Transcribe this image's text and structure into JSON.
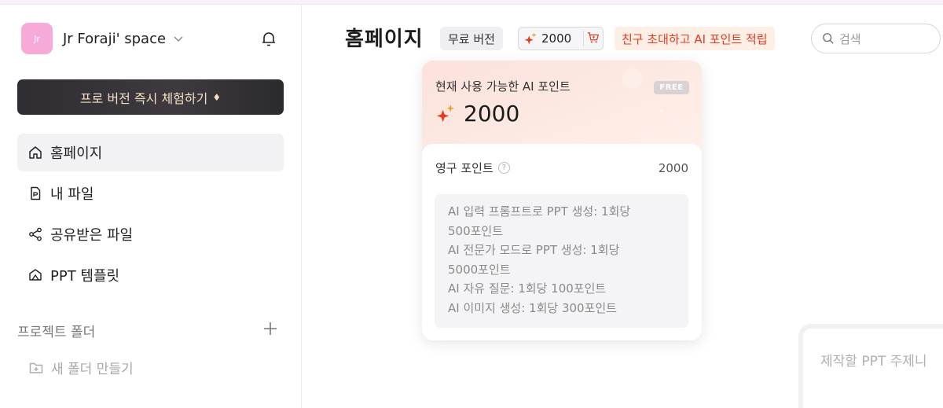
{
  "sidebar": {
    "workspace": {
      "avatar_text": "Jr",
      "name": "Jr Foraji' space"
    },
    "pro_button_label": "프로 버전 즉시 체험하기",
    "items": [
      {
        "label": "홈페이지",
        "icon": "home-icon",
        "active": true
      },
      {
        "label": "내 파일",
        "icon": "file-icon",
        "active": false
      },
      {
        "label": "공유받은 파일",
        "icon": "share-icon",
        "active": false
      },
      {
        "label": "PPT 템플릿",
        "icon": "template-icon",
        "active": false
      }
    ],
    "project_folder_label": "프로젝트 폴더",
    "new_folder_label": "새 폴더 만들기"
  },
  "header": {
    "title": "홈페이지",
    "plan_badge": "무료 버전",
    "points": "2000",
    "invite_label": "친구 초대하고 AI 포인트 적립",
    "search_placeholder": "검색"
  },
  "popover": {
    "available_label": "현재 사용 가능한 AI 포인트",
    "free_tag": "FREE",
    "available_points": "2000",
    "permanent_label": "영구 포인트",
    "permanent_value": "2000",
    "help_glyph": "?",
    "info_lines": [
      "AI 입력 프롬프트로 PPT 생성: 1회당",
      "500포인트",
      "AI 전문가 모드로 PPT 생성: 1회당",
      "5000포인트",
      "AI 자유 질문: 1회당 100포인트",
      "AI 이미지 생성: 1회당 300포인트"
    ]
  },
  "main": {
    "prompt_placeholder": "제작할 PPT 주제니"
  },
  "colors": {
    "accent_red": "#e8391f",
    "invite_bg": "#fdeee6",
    "avatar_bg": "#f7a9d8",
    "pro_text": "#f4e0c2"
  }
}
